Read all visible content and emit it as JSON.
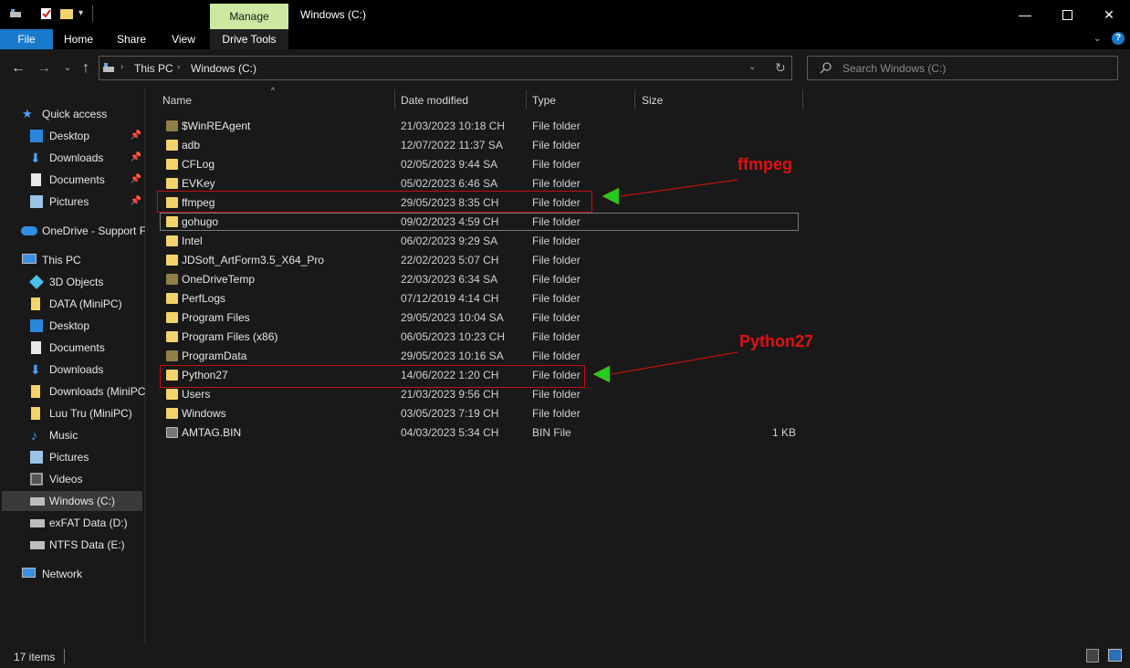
{
  "window": {
    "title": "Windows (C:)",
    "context_tab": "Manage",
    "controls": [
      "minimize",
      "maximize",
      "close"
    ]
  },
  "ribbon": {
    "tabs": [
      "File",
      "Home",
      "Share",
      "View",
      "Drive Tools"
    ]
  },
  "address": {
    "breadcrumb": [
      "This PC",
      "Windows (C:)"
    ],
    "search_placeholder": "Search Windows (C:)"
  },
  "columns": {
    "name": "Name",
    "date": "Date modified",
    "type": "Type",
    "size": "Size"
  },
  "nav": {
    "quick_access": "Quick access",
    "quick_items": [
      "Desktop",
      "Downloads",
      "Documents",
      "Pictures"
    ],
    "onedrive": "OneDrive - Support F",
    "this_pc": "This PC",
    "pc_items": [
      "3D Objects",
      "DATA (MiniPC)",
      "Desktop",
      "Documents",
      "Downloads",
      "Downloads (MiniPC",
      "Luu Tru (MiniPC)",
      "Music",
      "Pictures",
      "Videos",
      "Windows (C:)",
      "exFAT Data (D:)",
      "NTFS Data (E:)"
    ],
    "network": "Network"
  },
  "files": [
    {
      "name": "$WinREAgent",
      "date": "21/03/2023 10:18 CH",
      "type": "File folder",
      "size": "",
      "hidden": true
    },
    {
      "name": "adb",
      "date": "12/07/2022 11:37 SA",
      "type": "File folder",
      "size": ""
    },
    {
      "name": "CFLog",
      "date": "02/05/2023 9:44 SA",
      "type": "File folder",
      "size": ""
    },
    {
      "name": "EVKey",
      "date": "05/02/2023 6:46 SA",
      "type": "File folder",
      "size": ""
    },
    {
      "name": "ffmpeg",
      "date": "29/05/2023 8:35 CH",
      "type": "File folder",
      "size": ""
    },
    {
      "name": "gohugo",
      "date": "09/02/2023 4:59 CH",
      "type": "File folder",
      "size": ""
    },
    {
      "name": "Intel",
      "date": "06/02/2023 9:29 SA",
      "type": "File folder",
      "size": ""
    },
    {
      "name": "JDSoft_ArtForm3.5_X64_Pro",
      "date": "22/02/2023 5:07 CH",
      "type": "File folder",
      "size": ""
    },
    {
      "name": "OneDriveTemp",
      "date": "22/03/2023 6:34 SA",
      "type": "File folder",
      "size": "",
      "hidden": true
    },
    {
      "name": "PerfLogs",
      "date": "07/12/2019 4:14 CH",
      "type": "File folder",
      "size": ""
    },
    {
      "name": "Program Files",
      "date": "29/05/2023 10:04 SA",
      "type": "File folder",
      "size": ""
    },
    {
      "name": "Program Files (x86)",
      "date": "06/05/2023 10:23 CH",
      "type": "File folder",
      "size": ""
    },
    {
      "name": "ProgramData",
      "date": "29/05/2023 10:16 SA",
      "type": "File folder",
      "size": "",
      "hidden": true
    },
    {
      "name": "Python27",
      "date": "14/06/2022 1:20 CH",
      "type": "File folder",
      "size": ""
    },
    {
      "name": "Users",
      "date": "21/03/2023 9:56 CH",
      "type": "File folder",
      "size": ""
    },
    {
      "name": "Windows",
      "date": "03/05/2023 7:19 CH",
      "type": "File folder",
      "size": ""
    },
    {
      "name": "AMTAG.BIN",
      "date": "04/03/2023 5:34 CH",
      "type": "BIN File",
      "size": "1 KB",
      "bin": true
    }
  ],
  "status": {
    "count": "17 items"
  },
  "annotations": {
    "a1": "ffmpeg",
    "a2": "Python27"
  },
  "colors": {
    "accent": "#1979ca",
    "folder": "#f3d36b",
    "highlight": "#c01010",
    "arrow": "#22cc22"
  }
}
